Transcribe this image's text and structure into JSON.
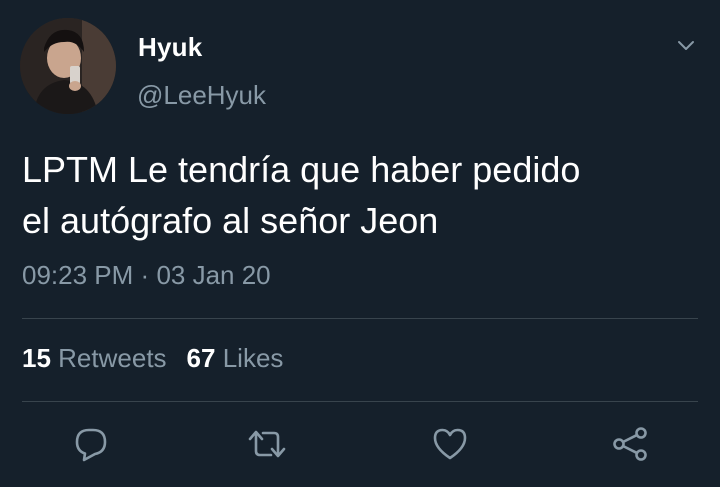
{
  "tweet": {
    "author": {
      "display_name": "Hyuk",
      "handle": "@LeeHyuk"
    },
    "text_line1": "LPTM Le tendría que haber pedido",
    "text_line2": "el autógrafo al señor Jeon",
    "time": "09:23 PM",
    "separator": "·",
    "date": "03 Jan 20",
    "stats": {
      "retweets_count": "15",
      "retweets_label": "Retweets",
      "likes_count": "67",
      "likes_label": "Likes"
    }
  },
  "icons": {
    "menu": "chevron-down-icon",
    "reply": "reply-icon",
    "retweet": "retweet-icon",
    "like": "heart-icon",
    "share": "share-icon"
  },
  "colors": {
    "background": "#15202b",
    "secondary_text": "#8899a6",
    "divider": "#38444d",
    "icon": "#8899a6"
  }
}
